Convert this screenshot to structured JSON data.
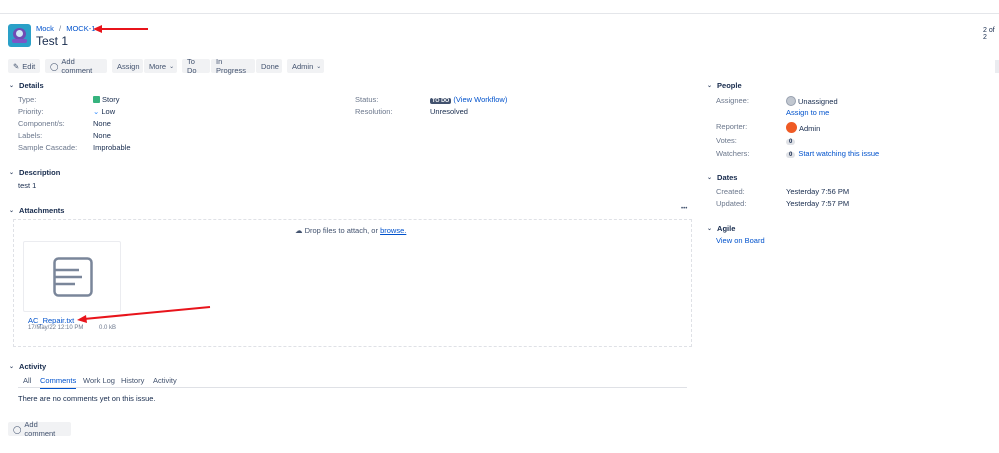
{
  "header": {
    "breadcrumb_project": "Mock",
    "breadcrumb_sep": "/",
    "breadcrumb_key": "MOCK-1",
    "title": "Test 1",
    "pager": "2 of 2"
  },
  "toolbar": {
    "edit": "Edit",
    "add_comment": "Add comment",
    "assign": "Assign",
    "more": "More",
    "todo": "To Do",
    "in_progress": "In Progress",
    "done": "Done",
    "admin": "Admin"
  },
  "details": {
    "heading": "Details",
    "type_label": "Type:",
    "type": "Story",
    "priority_label": "Priority:",
    "priority": "Low",
    "components_label": "Component/s:",
    "components": "None",
    "labels_label": "Labels:",
    "labels": "None",
    "cascade_label": "Sample Cascade:",
    "cascade": "Improbable",
    "status_label": "Status:",
    "status": "TO DO",
    "view_workflow": "(View Workflow)",
    "resolution_label": "Resolution:",
    "resolution": "Unresolved"
  },
  "description": {
    "heading": "Description",
    "text": "test 1"
  },
  "attachments": {
    "heading": "Attachments",
    "more": "•••",
    "drop_text": "Drop files to attach, or",
    "browse": "browse.",
    "file_name": "AC_Repair.txt",
    "file_date": "17/May/22 12:10 PM",
    "file_size": "0.0 kB"
  },
  "activity": {
    "heading": "Activity",
    "tabs": [
      "All",
      "Comments",
      "Work Log",
      "History",
      "Activity"
    ],
    "empty": "There are no comments yet on this issue.",
    "add_comment": "Add comment"
  },
  "people": {
    "heading": "People",
    "assignee_label": "Assignee:",
    "assignee": "Unassigned",
    "assign_to_me": "Assign to me",
    "reporter_label": "Reporter:",
    "reporter": "Admin",
    "votes_label": "Votes:",
    "votes": "0",
    "watchers_label": "Watchers:",
    "watchers": "0",
    "start_watching": "Start watching this issue"
  },
  "dates": {
    "heading": "Dates",
    "created_label": "Created:",
    "created": "Yesterday 7:56 PM",
    "updated_label": "Updated:",
    "updated": "Yesterday 7:57 PM"
  },
  "agile": {
    "heading": "Agile",
    "view_on_board": "View on Board"
  },
  "colors": {
    "link": "#0052cc",
    "annotation": "#e8141b"
  }
}
